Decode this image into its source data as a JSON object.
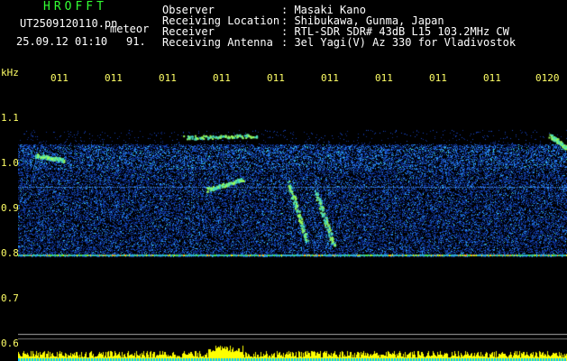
{
  "header": {
    "logo": "HROFFT",
    "filename": "UT2509120110.pn",
    "meteor_label": "meteor",
    "datetime": "25.09.12 01:10",
    "count": "91.",
    "fields": [
      {
        "label": "Observer",
        "value": ": Masaki Kano"
      },
      {
        "label": "Receiving Location",
        "value": ": Shibukawa, Gunma, Japan"
      },
      {
        "label": "Receiver",
        "value": ": RTL-SDR SDR# 43dB L15 103.2MHz CW"
      },
      {
        "label": "Receiving Antenna",
        "value": ": 3el Yagi(V) Az 330 for Vladivostok"
      }
    ]
  },
  "axis": {
    "unit": "kHz",
    "ticks": [
      "1.1",
      "1.0",
      "0.9",
      "0.8",
      "0.7",
      "0.6"
    ],
    "time_labels": [
      "011",
      "011",
      "011",
      "011",
      "011",
      "011",
      "011",
      "011",
      "011",
      "0120"
    ]
  },
  "colors": {
    "background": "#000000",
    "header_text": "#ffffff",
    "logo": "#33ff33",
    "axis_text": "#ffff66"
  }
}
